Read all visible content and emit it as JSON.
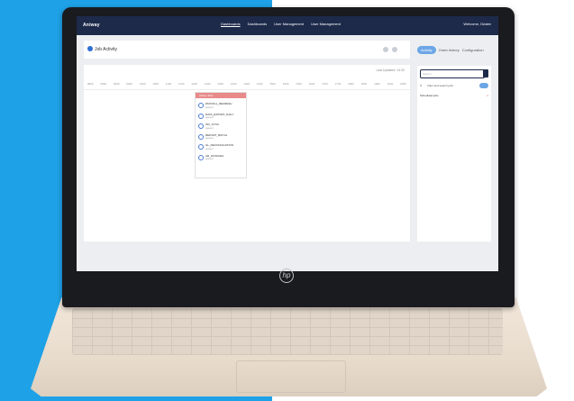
{
  "app": {
    "brand": "Aniway",
    "nav": [
      "Dashboards",
      "Dashboards",
      "User Management",
      "User Management"
    ],
    "nav_active_index": 0,
    "user": "Welcome, Dealer"
  },
  "page": {
    "title": "Job Activity",
    "last_updated": "Last Updated: 14:32"
  },
  "timeline": {
    "columns": [
      "0800",
      "0830",
      "0900",
      "0930",
      "1000",
      "1030",
      "1100",
      "1130",
      "1200",
      "1230",
      "1300",
      "1330",
      "1400",
      "1430",
      "1500",
      "1530",
      "1600",
      "1630",
      "1700",
      "1730",
      "1800",
      "1830",
      "1900",
      "1930",
      "2000"
    ]
  },
  "panel": {
    "header": "Active Jobs",
    "items": [
      {
        "title": "PAYROLL_REFRESH",
        "sub": "queued"
      },
      {
        "title": "DATA_EXPORT_DAILY",
        "sub": "queued"
      },
      {
        "title": "INV_SYNC",
        "sub": "queued"
      },
      {
        "title": "REPORT_BATCH",
        "sub": "queued"
      },
      {
        "title": "GL_RECONCILIATION",
        "sub": "queued"
      },
      {
        "title": "AR_INVOICES",
        "sub": "queued"
      }
    ]
  },
  "sidebar": {
    "tabs": [
      "Activity",
      "Order history",
      "Configuration"
    ],
    "search_placeholder": "Search",
    "filter_label": "Filter and search jobs",
    "result_label": "Scheduled jobs",
    "result_badge": "2"
  },
  "colors": {
    "topbar": "#1d2a4a",
    "accent": "#6ca6e6",
    "background_left": "#1ea1e6"
  },
  "icons": [
    "hp-logo-icon",
    "search-icon",
    "filter-icon",
    "bell-icon"
  ]
}
